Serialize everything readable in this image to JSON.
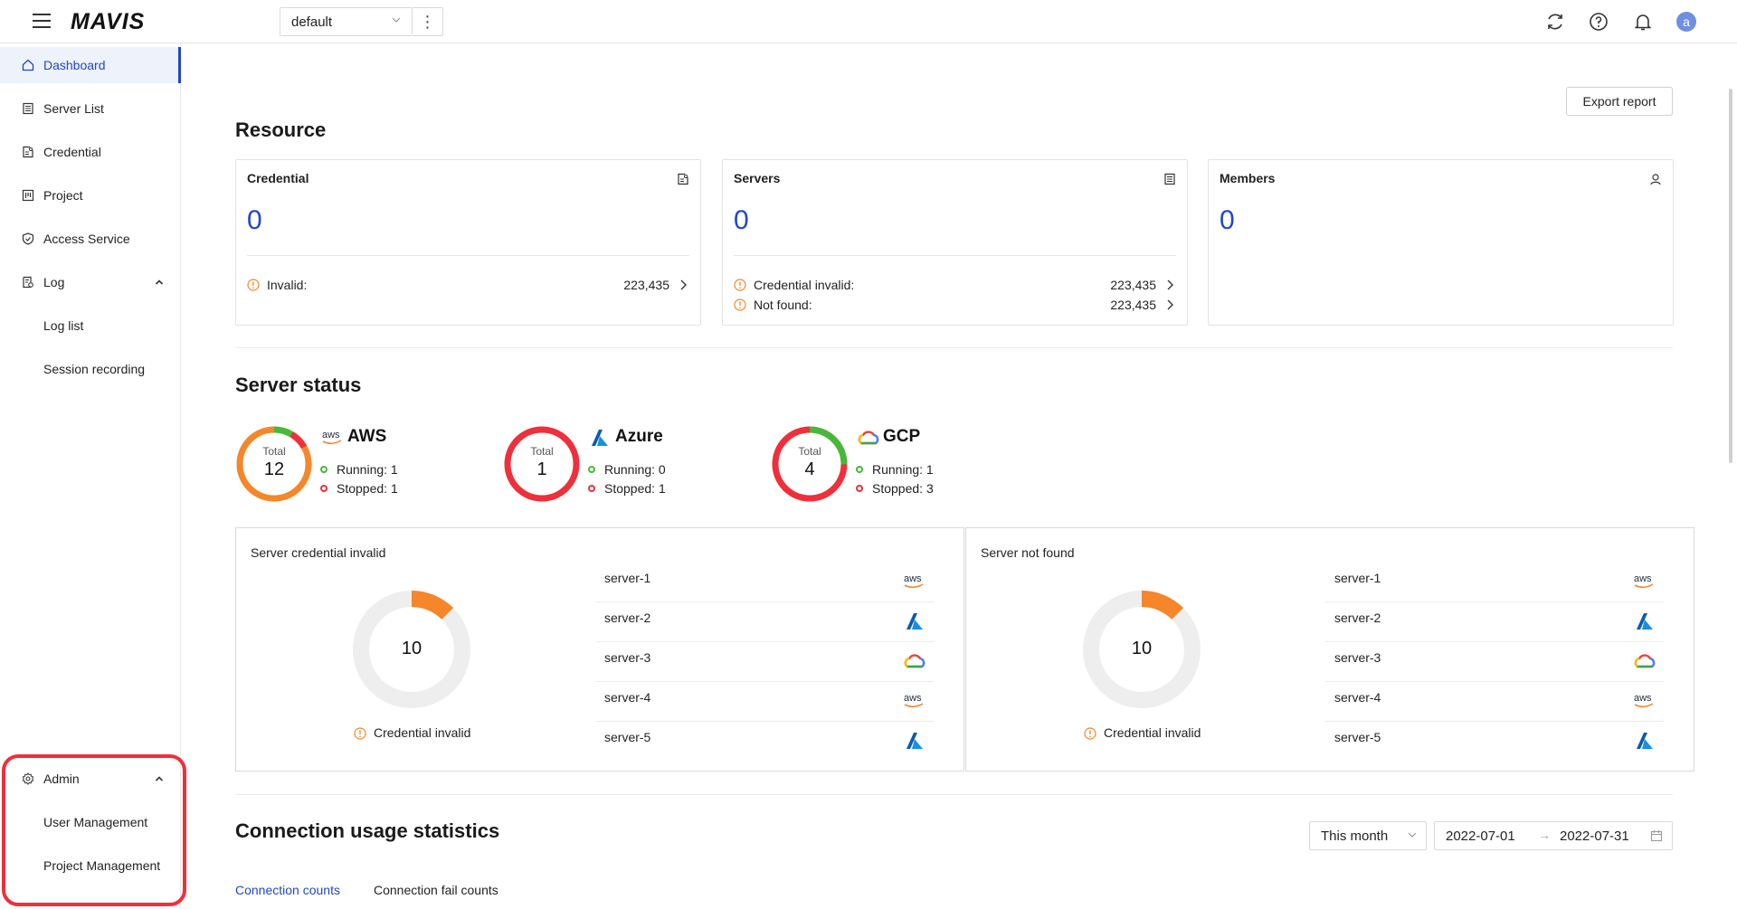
{
  "topbar": {
    "logo": "MAVIS",
    "workspace": "default",
    "more": "⋮",
    "avatar": "a"
  },
  "sidebar": {
    "items": [
      {
        "label": "Dashboard",
        "icon": "home-icon",
        "active": true
      },
      {
        "label": "Server List",
        "icon": "server-list-icon"
      },
      {
        "label": "Credential",
        "icon": "credential-icon"
      },
      {
        "label": "Project",
        "icon": "project-icon"
      },
      {
        "label": "Access Service",
        "icon": "shield-icon"
      },
      {
        "label": "Log",
        "icon": "log-icon",
        "expanded": true
      },
      {
        "label": "Log list"
      },
      {
        "label": "Session recording"
      }
    ],
    "admin": {
      "label": "Admin",
      "icon": "gear-icon",
      "children": [
        "User Management",
        "Project Management"
      ]
    }
  },
  "main": {
    "export_label": "Export report",
    "resource": {
      "title": "Resource",
      "cards": [
        {
          "title": "Credential",
          "icon": "credential-icon",
          "value": "0",
          "rows": [
            {
              "label": "Invalid:",
              "value": "223,435"
            }
          ]
        },
        {
          "title": "Servers",
          "icon": "server-list-icon",
          "value": "0",
          "rows": [
            {
              "label": "Credential invalid:",
              "value": "223,435"
            },
            {
              "label": "Not found:",
              "value": "223,435"
            }
          ]
        },
        {
          "title": "Members",
          "icon": "user-icon",
          "value": "0",
          "rows": []
        }
      ]
    },
    "server_status": {
      "title": "Server status",
      "total_label": "Total",
      "clouds": [
        {
          "name": "AWS",
          "total": "12",
          "running": "Running: 1",
          "stopped": "Stopped: 1"
        },
        {
          "name": "Azure",
          "total": "1",
          "running": "Running: 0",
          "stopped": "Stopped: 1"
        },
        {
          "name": "GCP",
          "total": "4",
          "running": "Running: 1",
          "stopped": "Stopped: 3"
        }
      ]
    },
    "panels": [
      {
        "title": "Server credential invalid",
        "value": "10",
        "legend": "Credential invalid",
        "servers": [
          {
            "name": "server-1",
            "provider": "aws"
          },
          {
            "name": "server-2",
            "provider": "azure"
          },
          {
            "name": "server-3",
            "provider": "gcp"
          },
          {
            "name": "server-4",
            "provider": "aws"
          },
          {
            "name": "server-5",
            "provider": "azure"
          }
        ]
      },
      {
        "title": "Server not found",
        "value": "10",
        "legend": "Credential invalid",
        "servers": [
          {
            "name": "server-1",
            "provider": "aws"
          },
          {
            "name": "server-2",
            "provider": "azure"
          },
          {
            "name": "server-3",
            "provider": "gcp"
          },
          {
            "name": "server-4",
            "provider": "aws"
          },
          {
            "name": "server-5",
            "provider": "azure"
          }
        ]
      }
    ],
    "connection": {
      "title": "Connection usage statistics",
      "range": "This month",
      "date_from": "2022-07-01",
      "date_to": "2022-07-31",
      "tabs": [
        "Connection counts",
        "Connection fail counts"
      ]
    }
  },
  "colors": {
    "accent": "#2147c9",
    "orange": "#f5862a",
    "green": "#47b93a",
    "red": "#ef2f3a",
    "highlight": "#ef2f3a"
  }
}
